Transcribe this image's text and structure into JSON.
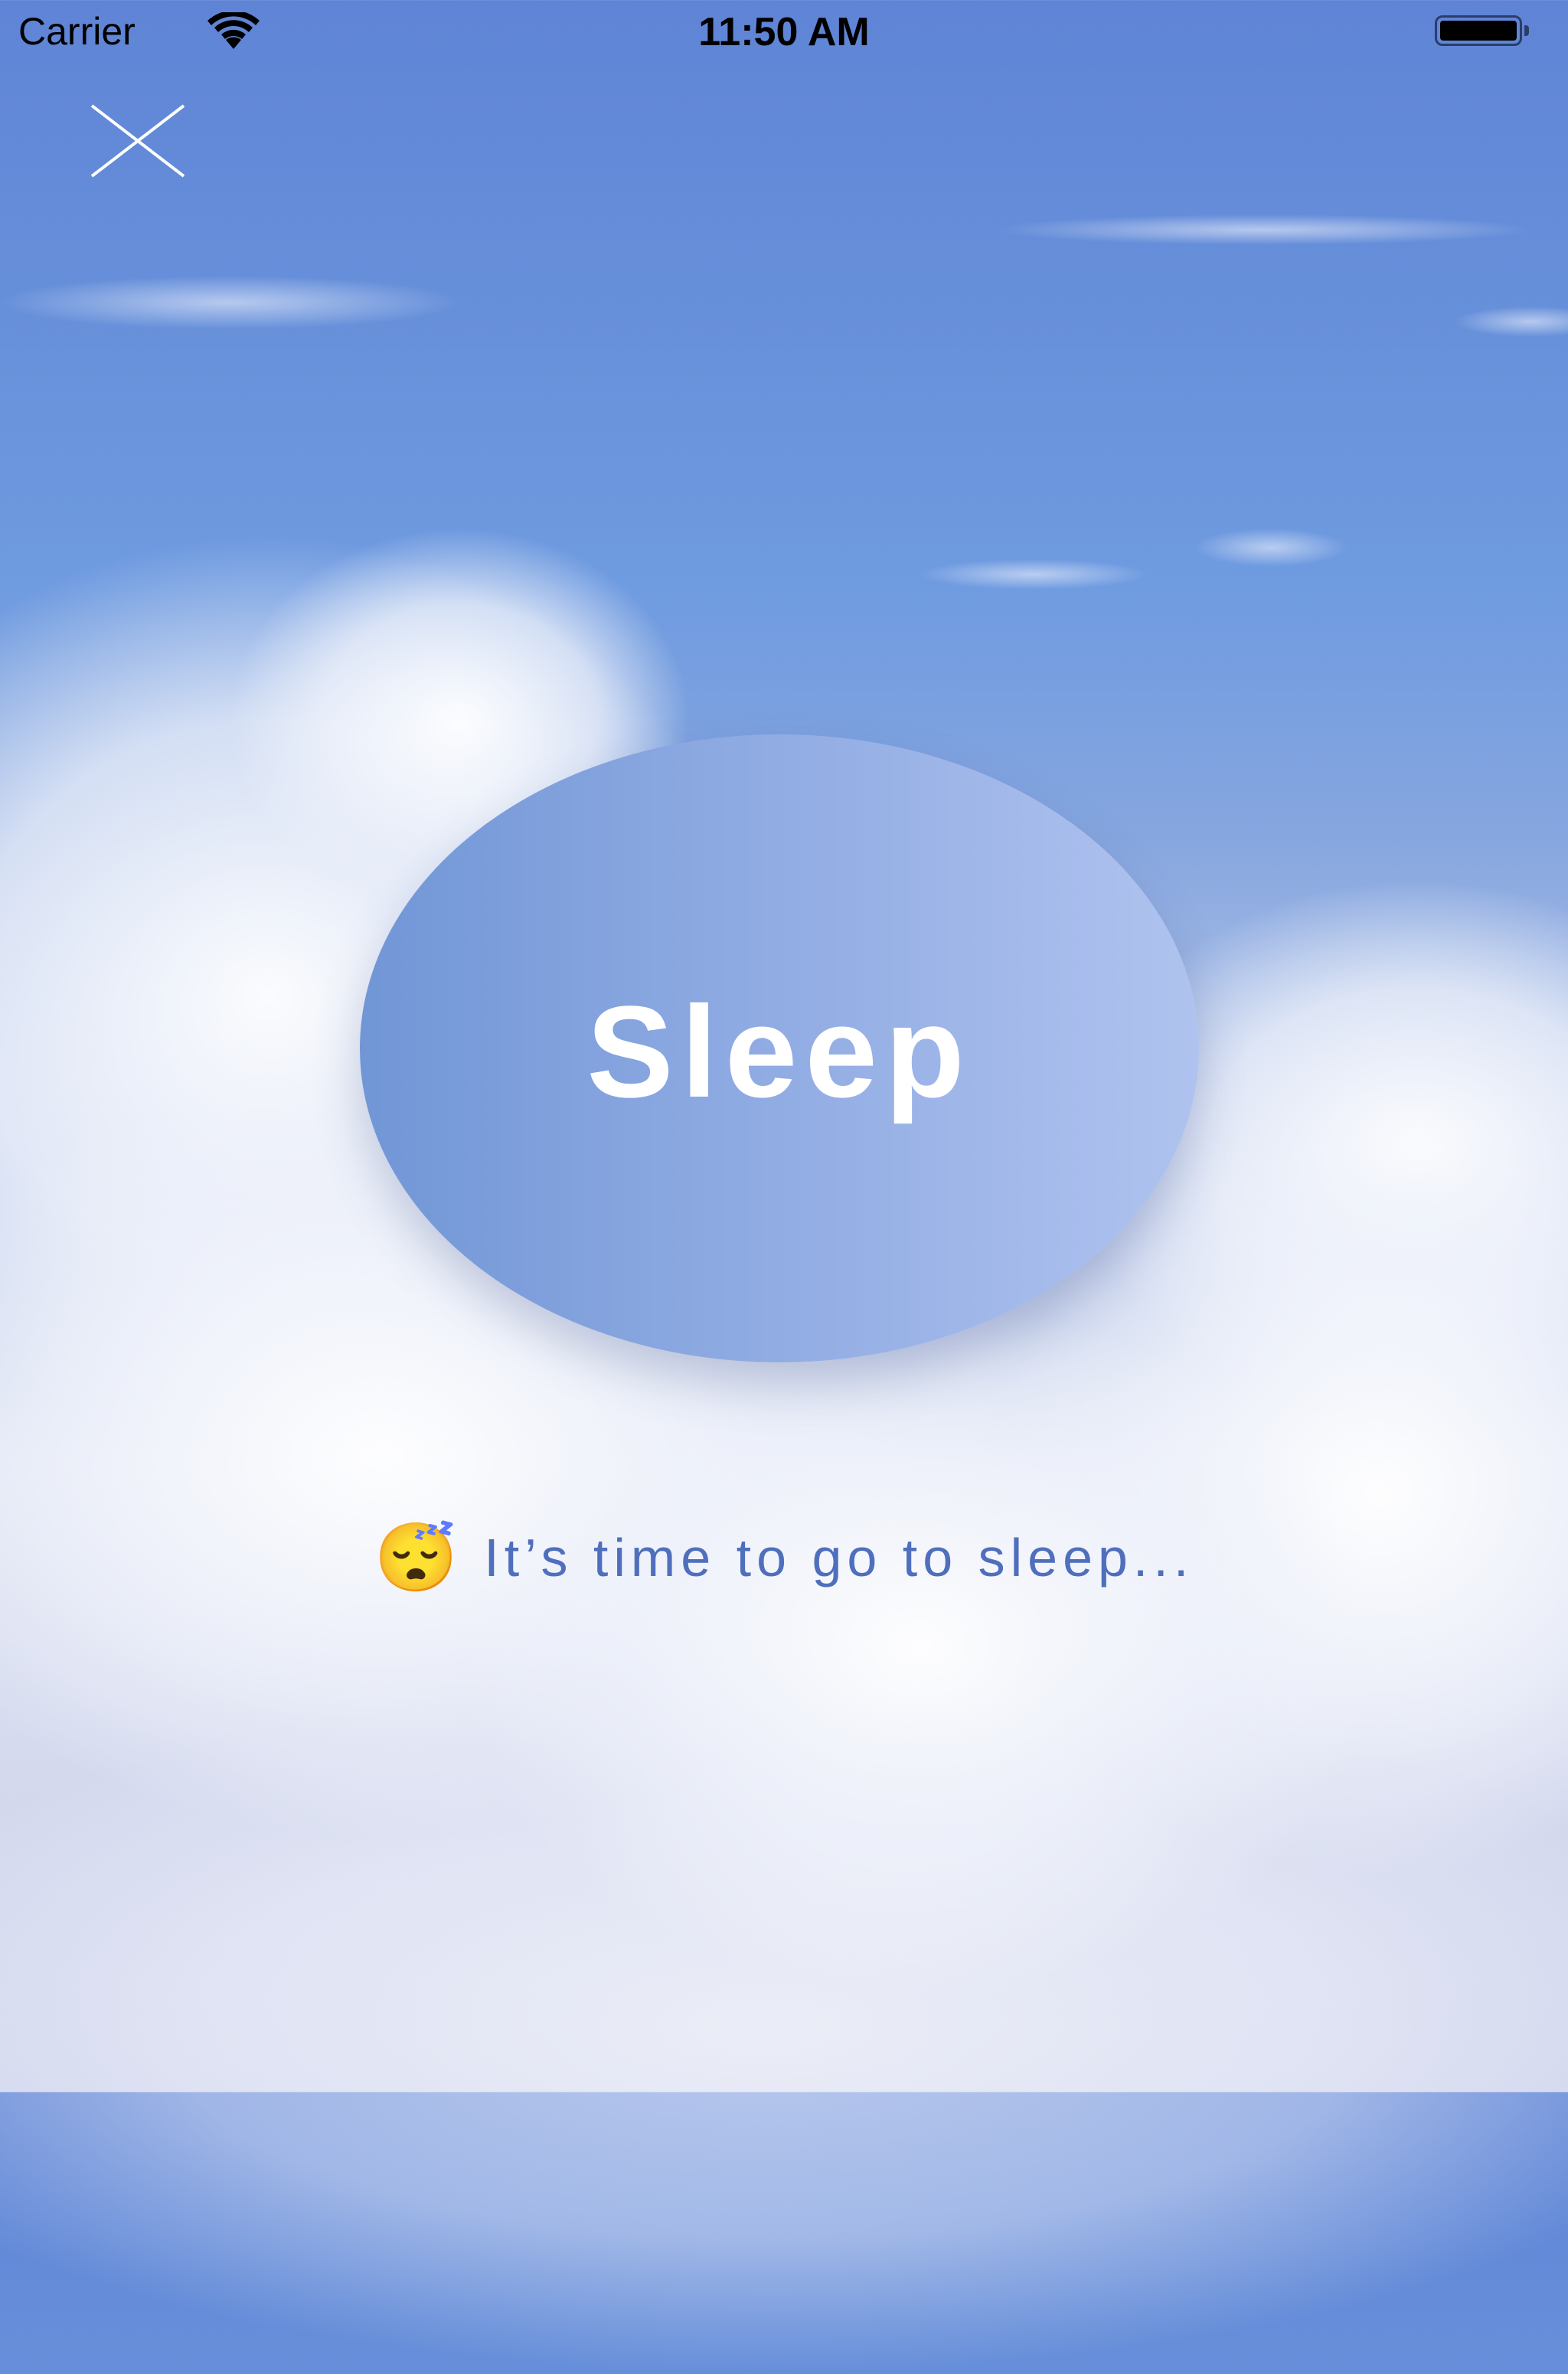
{
  "status_bar": {
    "carrier": "Carrier",
    "time": "11:50 AM"
  },
  "sleep_button": {
    "label": "Sleep"
  },
  "message": {
    "emoji": "😴",
    "text": "It’s time to go to sleep..."
  },
  "colors": {
    "accent": "#8eaae2",
    "text": "#4f6fbd",
    "sky": "#6790da"
  }
}
